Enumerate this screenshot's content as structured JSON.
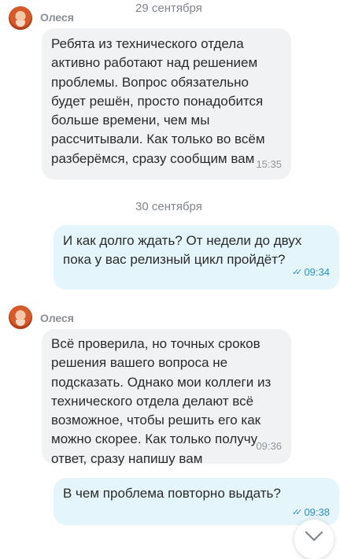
{
  "messages": [
    {
      "type": "date",
      "text": "29 сентября"
    },
    {
      "type": "incoming",
      "sender": "Олеся",
      "text": "Ребята из технического отдела активно работают над решением проблемы. Вопрос обязательно будет решён, просто понадобится больше времени, чем мы рассчитывали. Как только во всём разберёмся, сразу сообщим вам",
      "time": "15:35"
    },
    {
      "type": "date",
      "text": "30 сентября"
    },
    {
      "type": "outgoing",
      "text": "И как долго ждать? От недели до двух пока у вас релизный цикл пройдёт?",
      "time": "09:34"
    },
    {
      "type": "incoming",
      "sender": "Олеся",
      "text": "Всё проверила, но точных сроков решения вашего вопроса не подсказать. Однако мои коллеги из технического отдела делают всё возможное, чтобы решить его как можно скорее. Как только получу ответ, сразу напишу вам",
      "time": "09:36"
    },
    {
      "type": "outgoing",
      "text": "В чем проблема повторно выдать?",
      "time": "09:38"
    }
  ],
  "icons": {
    "read_receipt": "double-check-icon",
    "scroll_down": "chevron-down-icon",
    "avatar": "avatar"
  },
  "colors": {
    "incoming_bubble": "#f1f2f4",
    "outgoing_bubble": "#e4f5fb",
    "accent": "#2f91c4"
  }
}
